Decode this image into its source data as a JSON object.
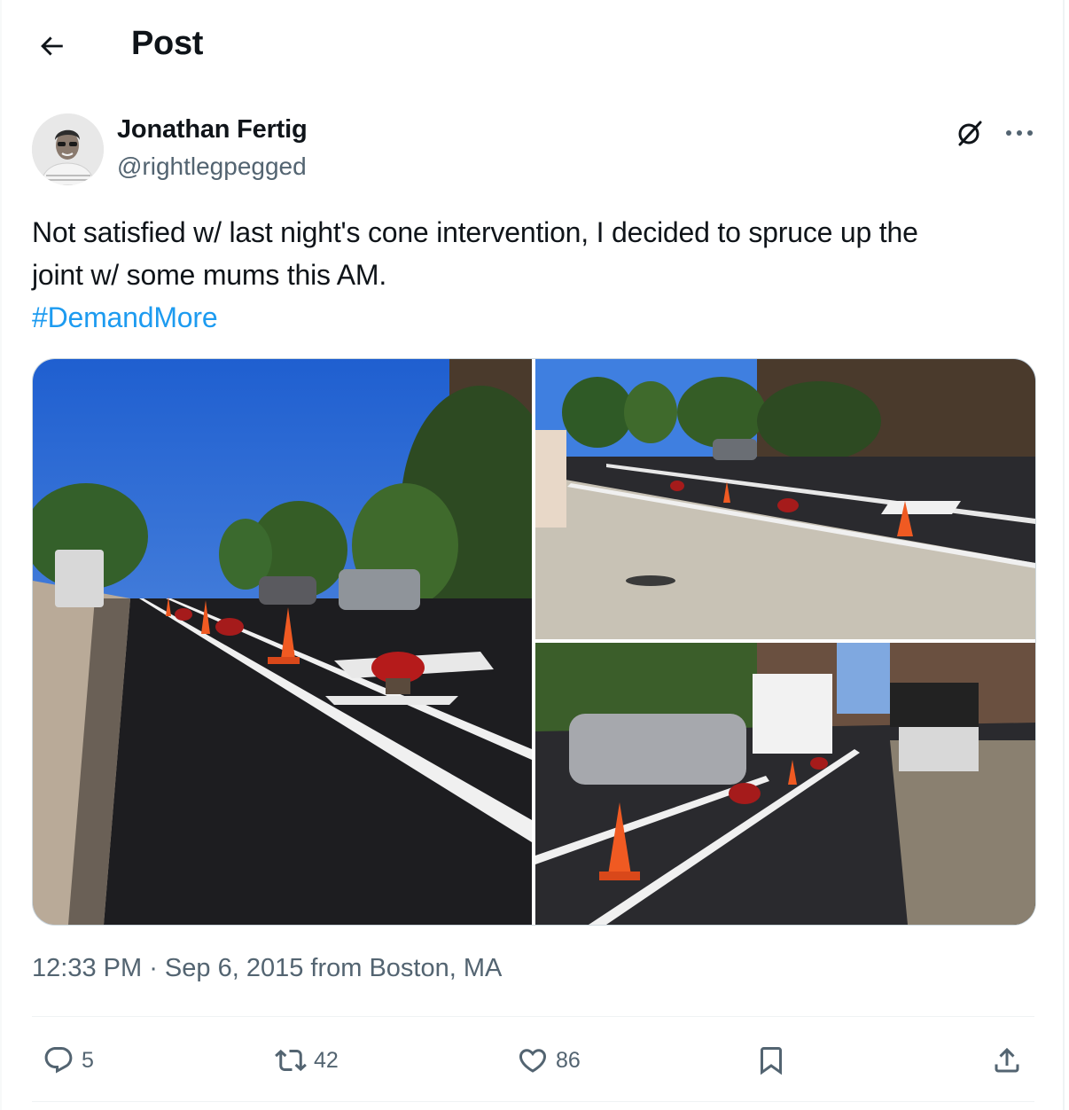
{
  "header": {
    "title": "Post",
    "back_icon": "arrow-left-icon"
  },
  "author": {
    "name": "Jonathan Fertig",
    "handle": "@rightlegpegged"
  },
  "post": {
    "text_line1": "Not satisfied w/ last night's cone intervention, I decided to spruce up the",
    "text_line2": "joint w/ some mums this AM.",
    "hashtag": "#DemandMore",
    "photo_count": 3
  },
  "meta": {
    "time": "12:33 PM",
    "separator": " · ",
    "date": "Sep 6, 2015",
    "location": "from Boston, MA"
  },
  "actions": {
    "replies": "5",
    "reposts": "42",
    "likes": "86"
  },
  "colors": {
    "accent": "#1d9bf0",
    "secondary_text": "#536471",
    "primary_text": "#0f1419",
    "border": "#cfd9de"
  }
}
